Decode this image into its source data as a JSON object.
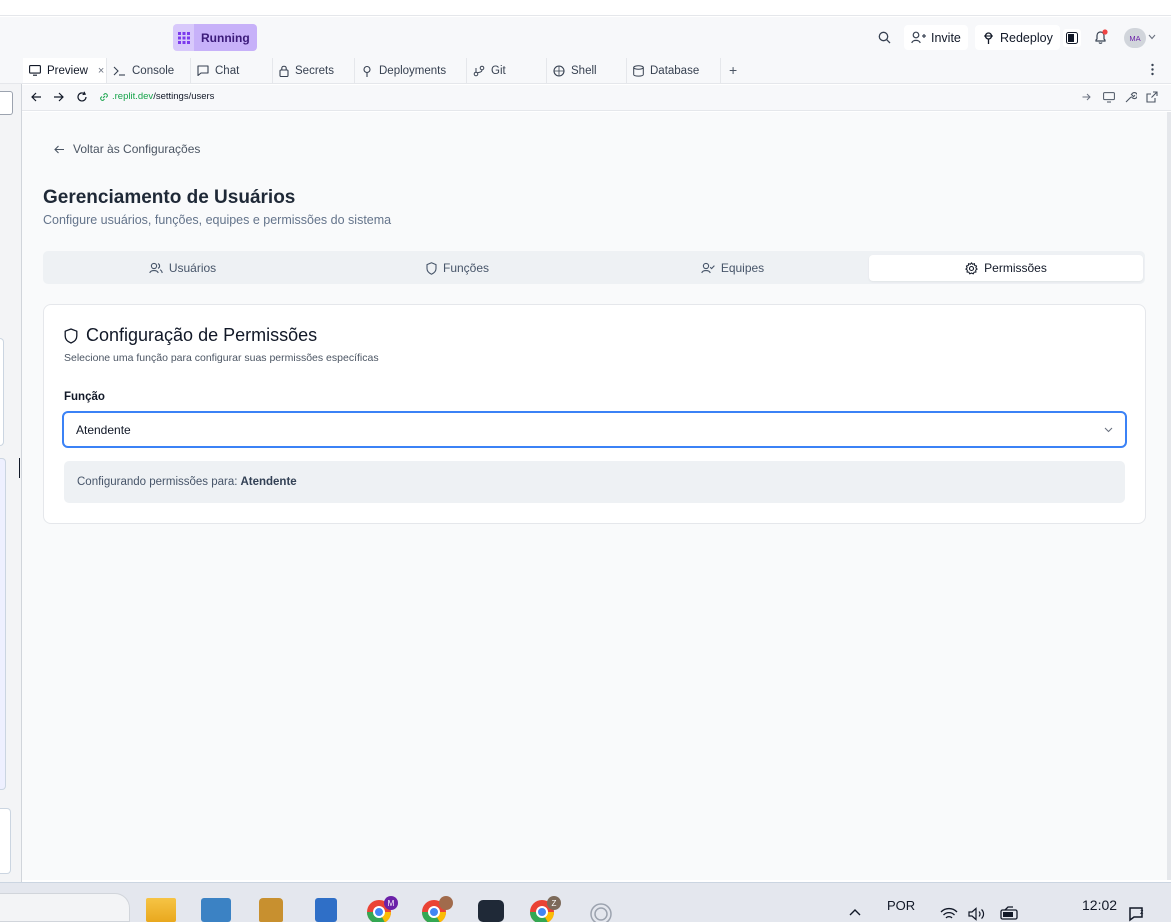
{
  "header": {
    "run_status": "Running",
    "invite_label": "Invite",
    "redeploy_label": "Redeploy",
    "avatar_initials": "MA"
  },
  "workspace_tabs": [
    {
      "label": "Preview",
      "icon": "preview-icon",
      "active": true,
      "closable": true
    },
    {
      "label": "Console",
      "icon": "console-icon"
    },
    {
      "label": "Chat",
      "icon": "chat-icon"
    },
    {
      "label": "Secrets",
      "icon": "lock-icon"
    },
    {
      "label": "Deployments",
      "icon": "deploy-icon"
    },
    {
      "label": "Git",
      "icon": "git-icon"
    },
    {
      "label": "Shell",
      "icon": "shell-icon"
    },
    {
      "label": "Database",
      "icon": "database-icon"
    }
  ],
  "urlbar": {
    "domain": ".replit.dev",
    "path": "/settings/users"
  },
  "page": {
    "back_link": "Voltar às Configurações",
    "title": "Gerenciamento de Usuários",
    "subtitle": "Configure usuários, funções, equipes e permissões do sistema",
    "tabs": [
      {
        "label": "Usuários",
        "icon": "users-icon"
      },
      {
        "label": "Funções",
        "icon": "shield-icon"
      },
      {
        "label": "Equipes",
        "icon": "user-check-icon"
      },
      {
        "label": "Permissões",
        "icon": "gear-icon",
        "active": true
      }
    ],
    "card": {
      "title": "Configuração de Permissões",
      "description": "Selecione uma função para configurar suas permissões específicas",
      "field_label": "Função",
      "selected_role": "Atendente",
      "info_prefix": "Configurando permissões para:",
      "info_role": "Atendente"
    }
  },
  "taskbar": {
    "language": "POR",
    "time": "12:02"
  },
  "colors": {
    "accent": "#3b82f6",
    "running_bg": "#c7b1f9",
    "url_domain": "#16a34a"
  }
}
